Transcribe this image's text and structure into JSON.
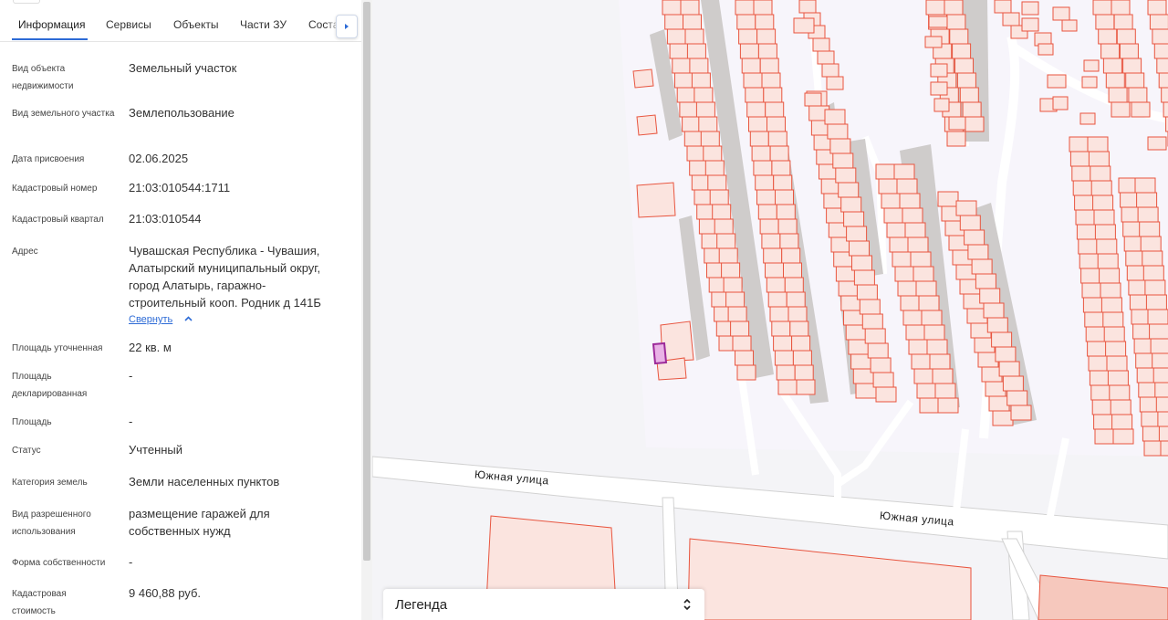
{
  "tabs": [
    {
      "label": "Информация",
      "active": true
    },
    {
      "label": "Сервисы",
      "active": false
    },
    {
      "label": "Объекты",
      "active": false
    },
    {
      "label": "Части ЗУ",
      "active": false
    },
    {
      "label": "Соста",
      "active": false
    }
  ],
  "info": {
    "object_type_label": "Вид объекта недвижимости",
    "object_type_value": "Земельный участок",
    "land_type_label": "Вид земельного участка",
    "land_type_value": "Землепользование",
    "assigned_date_label": "Дата присвоения",
    "assigned_date_value": "02.06.2025",
    "cadastral_number_label": "Кадастровый номер",
    "cadastral_number_value": "21:03:010544:1711",
    "cadastral_quarter_label": "Кадастровый квартал",
    "cadastral_quarter_value": "21:03:010544",
    "address_label": "Адрес",
    "address_value": "Чувашская Республика - Чувашия, Алатырский муниципальный округ, город Алатырь, гаражно-строительный кооп. Родник д 141Б",
    "collapse_link": "Свернуть",
    "area_specified_label": "Площадь уточненная",
    "area_specified_value": "22 кв. м",
    "area_declared_label": "Площадь декларированная",
    "area_declared_value": "-",
    "area_label": "Площадь",
    "area_value": "-",
    "status_label": "Статус",
    "status_value": "Учтенный",
    "land_category_label": "Категория земель",
    "land_category_value": "Земли населенных пунктов",
    "permitted_use_label": "Вид разрешенного использования",
    "permitted_use_value": "размещение гаражей для собственных нужд",
    "ownership_label": "Форма собственности",
    "ownership_value": "-",
    "cadastral_value_label": "Кадастровая стоимость",
    "cadastral_value_value": "9 460,88 руб."
  },
  "map": {
    "street_label_1": "Южная улица",
    "street_label_2": "Южная улица",
    "legend_title": "Легенда",
    "colors": {
      "parcel_stroke": "#e8553f",
      "parcel_fill": "#fbe4df",
      "building": "#cfcccb",
      "road": "#ffffff",
      "selected": "#9c2a9a",
      "accent": "#2d6bd6"
    }
  }
}
